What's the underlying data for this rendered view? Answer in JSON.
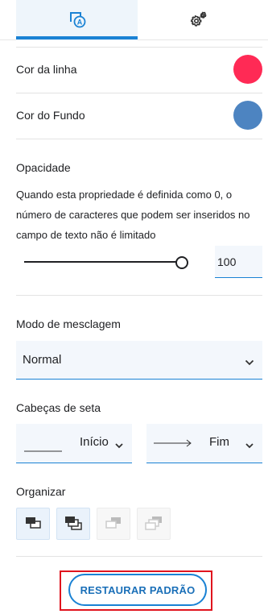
{
  "tabs": [
    {
      "name": "text-style",
      "icon": "text-format-icon",
      "active": true
    },
    {
      "name": "settings",
      "icon": "gear-icon",
      "active": false
    }
  ],
  "line_color": {
    "label": "Cor da linha",
    "color": "#ff2a55"
  },
  "fill_color": {
    "label": "Cor do Fundo",
    "color": "#4d84c1"
  },
  "opacity": {
    "title": "Opacidade",
    "description": "Quando esta propriedade é definida como 0, o número de caracteres que podem ser inseridos no campo de texto não é limitado",
    "value": "100",
    "slider_fraction": 1.0
  },
  "blend_mode": {
    "title": "Modo de mesclagem",
    "value": "Normal"
  },
  "arrowheads": {
    "title": "Cabeças de seta",
    "start_label": "Início",
    "end_label": "Fim"
  },
  "arrange": {
    "title": "Organizar",
    "buttons": [
      {
        "name": "bring-forward",
        "icon": "bring-forward-icon",
        "state": "active"
      },
      {
        "name": "bring-to-front",
        "icon": "bring-to-front-icon",
        "state": "active"
      },
      {
        "name": "send-backward",
        "icon": "send-backward-icon",
        "state": "disabled"
      },
      {
        "name": "send-to-back",
        "icon": "send-to-back-icon",
        "state": "disabled"
      }
    ]
  },
  "reset_label": "RESTAURAR PADRÃO",
  "colors": {
    "accent": "#1a82d4",
    "highlight": "#e0141e"
  }
}
